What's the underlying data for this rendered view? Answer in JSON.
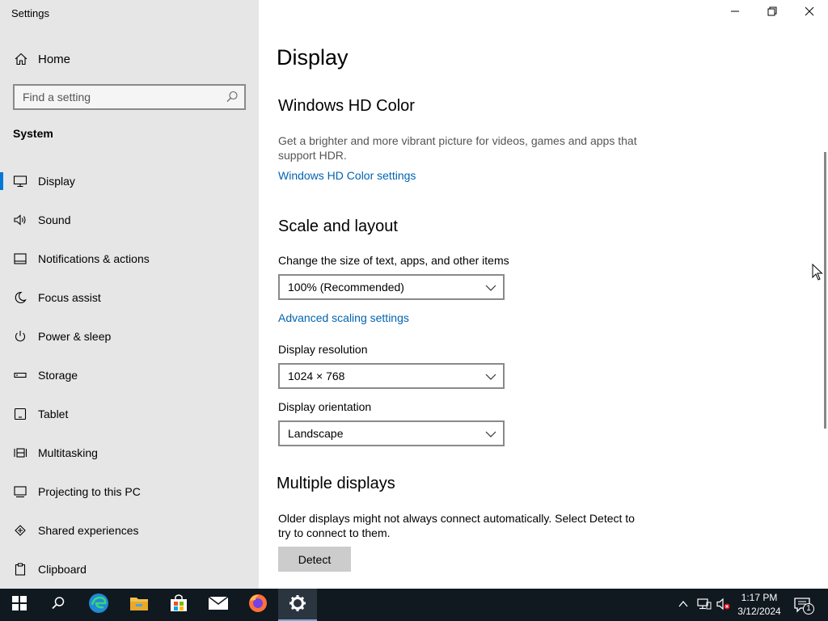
{
  "window": {
    "app_title": "Settings",
    "controls": {
      "minimize": "minimize-icon",
      "restore": "restore-icon",
      "close": "close-icon"
    }
  },
  "sidebar": {
    "home_label": "Home",
    "search_placeholder": "Find a setting",
    "section_label": "System",
    "items": [
      {
        "label": "Display",
        "icon": "monitor-icon",
        "selected": true
      },
      {
        "label": "Sound",
        "icon": "speaker-icon"
      },
      {
        "label": "Notifications & actions",
        "icon": "notification-icon"
      },
      {
        "label": "Focus assist",
        "icon": "moon-icon"
      },
      {
        "label": "Power & sleep",
        "icon": "power-icon"
      },
      {
        "label": "Storage",
        "icon": "storage-icon"
      },
      {
        "label": "Tablet",
        "icon": "tablet-icon"
      },
      {
        "label": "Multitasking",
        "icon": "multitasking-icon"
      },
      {
        "label": "Projecting to this PC",
        "icon": "projecting-icon"
      },
      {
        "label": "Shared experiences",
        "icon": "shared-experiences-icon"
      },
      {
        "label": "Clipboard",
        "icon": "clipboard-icon"
      }
    ]
  },
  "main": {
    "title": "Display",
    "hdr_heading": "Windows HD Color",
    "hdr_desc": "Get a brighter and more vibrant picture for videos, games and apps that support HDR.",
    "hdr_link": "Windows HD Color settings",
    "scale_heading": "Scale and layout",
    "scale_label": "Change the size of text, apps, and other items",
    "scale_value": "100% (Recommended)",
    "advanced_scaling_link": "Advanced scaling settings",
    "resolution_label": "Display resolution",
    "resolution_value": "1024 × 768",
    "orientation_label": "Display orientation",
    "orientation_value": "Landscape",
    "multiple_heading": "Multiple displays",
    "multiple_desc": "Older displays might not always connect automatically. Select Detect to try to connect to them.",
    "detect_button": "Detect"
  },
  "taskbar": {
    "apps": [
      "start-icon",
      "search-icon",
      "edge-icon",
      "file-explorer-icon",
      "store-icon",
      "mail-icon",
      "firefox-icon",
      "settings-icon"
    ],
    "time": "1:17 PM",
    "date": "3/12/2024",
    "notification_count": "1"
  },
  "colors": {
    "accent": "#0078d7",
    "link": "#0063b1",
    "sidebar_bg": "#e6e6e6",
    "taskbar_bg": "#101820"
  }
}
